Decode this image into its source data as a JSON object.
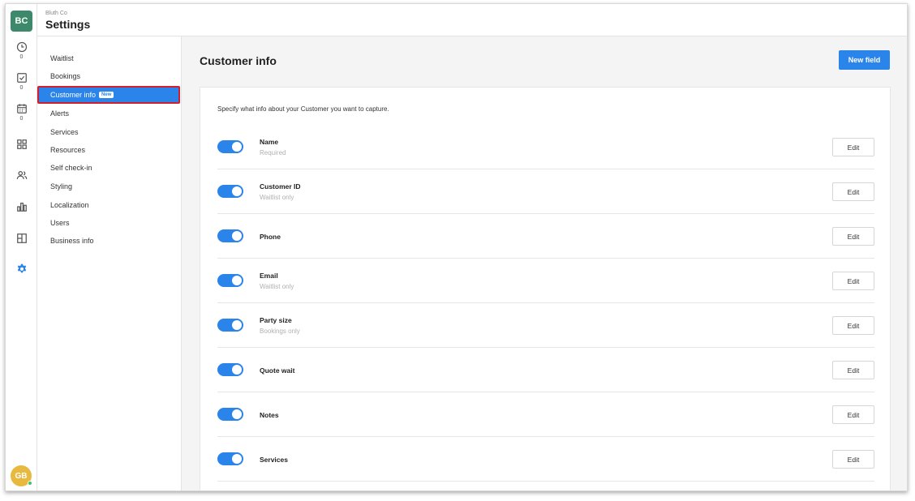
{
  "org": {
    "badge": "BC",
    "name": "Bluth Co"
  },
  "app": {
    "title": "Settings"
  },
  "rail": {
    "items": [
      {
        "icon": "clock-icon",
        "count": "0"
      },
      {
        "icon": "checkbox-icon",
        "count": "0"
      },
      {
        "icon": "calendar-icon",
        "count": "0"
      },
      {
        "icon": "apps-grid-icon"
      },
      {
        "icon": "users-icon"
      },
      {
        "icon": "bar-chart-icon"
      },
      {
        "icon": "layout-icon"
      },
      {
        "icon": "gear-icon"
      }
    ],
    "user_initials": "GB"
  },
  "subnav": {
    "items": [
      {
        "label": "Waitlist"
      },
      {
        "label": "Bookings"
      },
      {
        "label": "Customer info",
        "badge": "New",
        "active": true
      },
      {
        "label": "Alerts"
      },
      {
        "label": "Services"
      },
      {
        "label": "Resources"
      },
      {
        "label": "Self check-in"
      },
      {
        "label": "Styling"
      },
      {
        "label": "Localization"
      },
      {
        "label": "Users"
      },
      {
        "label": "Business info"
      }
    ]
  },
  "main": {
    "title": "Customer info",
    "new_field_label": "New field",
    "description": "Specify what info about your Customer you want to capture.",
    "edit_label": "Edit",
    "fields": [
      {
        "name": "Name",
        "sub": "Required",
        "enabled": true
      },
      {
        "name": "Customer ID",
        "sub": "Waitlist only",
        "enabled": true
      },
      {
        "name": "Phone",
        "sub": "",
        "enabled": true
      },
      {
        "name": "Email",
        "sub": "Waitlist only",
        "enabled": true
      },
      {
        "name": "Party size",
        "sub": "Bookings only",
        "enabled": true
      },
      {
        "name": "Quote wait",
        "sub": "",
        "enabled": true
      },
      {
        "name": "Notes",
        "sub": "",
        "enabled": true
      },
      {
        "name": "Services",
        "sub": "",
        "enabled": true
      }
    ]
  },
  "colors": {
    "accent": "#2b84ea",
    "org_badge": "#3c8a6b",
    "avatar": "#e7b93e",
    "highlight_border": "#d21f2e"
  }
}
